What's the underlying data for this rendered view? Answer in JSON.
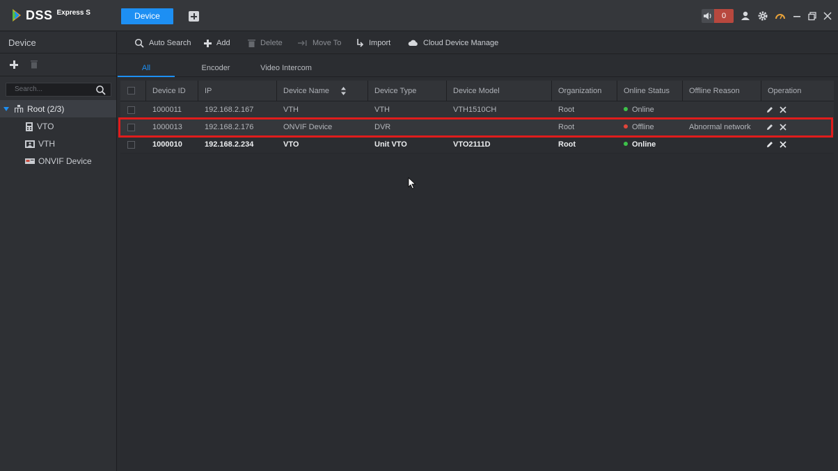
{
  "app": {
    "logo_text": "DSS",
    "logo_subtitle": "Express S",
    "active_tab": "Device",
    "alarm_count": "0",
    "accent_color": "#1d8ff3",
    "alarm_color": "#b8483e"
  },
  "window_icons": [
    "speaker-icon",
    "user-icon",
    "gear-icon",
    "gauge-icon",
    "minimize-icon",
    "restore-icon",
    "close-icon"
  ],
  "sidebar": {
    "title": "Device",
    "search_placeholder": "Search...",
    "root_label": "Root (2/3)",
    "items": [
      {
        "label": "VTO",
        "icon": "vto-device-icon"
      },
      {
        "label": "VTH",
        "icon": "vth-monitor-icon"
      },
      {
        "label": "ONVIF Device",
        "icon": "onvif-device-icon"
      }
    ]
  },
  "toolbar": {
    "auto_search": "Auto Search",
    "add": "Add",
    "delete": "Delete",
    "move_to": "Move To",
    "import": "Import",
    "cloud_manage": "Cloud Device Manage"
  },
  "tabs": [
    {
      "label": "All",
      "active": true
    },
    {
      "label": "Encoder",
      "active": false
    },
    {
      "label": "Video Intercom",
      "active": false
    }
  ],
  "table": {
    "columns": [
      "Device ID",
      "IP",
      "Device Name",
      "Device Type",
      "Device Model",
      "Organization",
      "Online Status",
      "Offline Reason",
      "Operation"
    ],
    "rows": [
      {
        "device_id": "1000011",
        "ip": "192.168.2.167",
        "name": "VTH",
        "type": "VTH",
        "model": "VTH1510CH",
        "org": "Root",
        "status": "Online",
        "status_color": "#3ec24a",
        "reason": ""
      },
      {
        "device_id": "1000013",
        "ip": "192.168.2.176",
        "name": "ONVIF Device",
        "type": "DVR",
        "model": "",
        "org": "Root",
        "status": "Offline",
        "status_color": "#e0453a",
        "reason": "Abnormal network"
      },
      {
        "device_id": "1000010",
        "ip": "192.168.2.234",
        "name": "VTO",
        "type": "Unit VTO",
        "model": "VTO2111D",
        "org": "Root",
        "status": "Online",
        "status_color": "#3ec24a",
        "reason": ""
      }
    ]
  },
  "highlight_color": "#e01c1c"
}
